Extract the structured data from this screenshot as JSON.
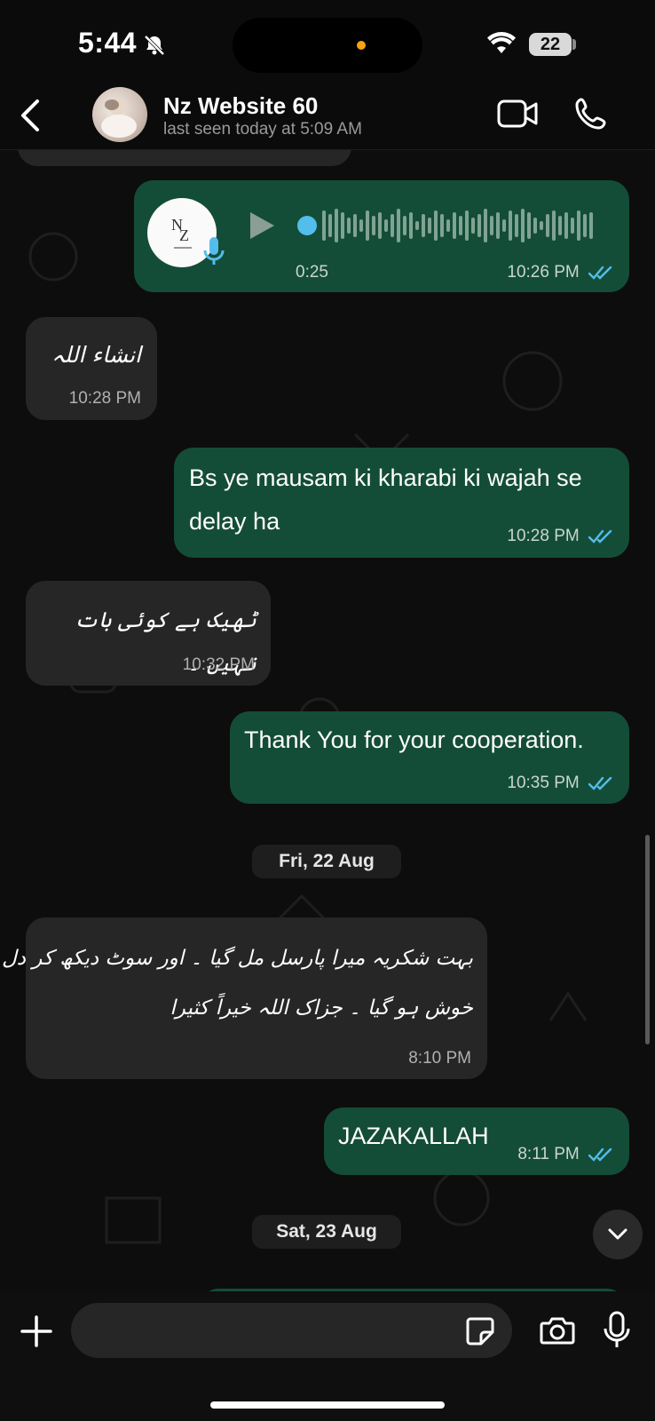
{
  "status_bar": {
    "time": "5:44",
    "battery": "22"
  },
  "header": {
    "contact_name": "Nz Website 60",
    "last_seen": "last seen today at 5:09 AM"
  },
  "voice_message": {
    "duration": "0:25",
    "time": "10:26 PM"
  },
  "messages": [
    {
      "direction": "in",
      "text": "انشاء اللہ",
      "time": "10:28 PM"
    },
    {
      "direction": "out",
      "text_line1": "Bs ye mausam ki kharabi ki wajah se",
      "text_line2": "delay ha",
      "time": "10:28 PM"
    },
    {
      "direction": "in",
      "text": "ٹھیک ہے کوئی بات نہیں ۔",
      "time": "10:32 PM"
    },
    {
      "direction": "out",
      "text": "Thank You for your cooperation.",
      "time": "10:35 PM"
    },
    {
      "direction": "in",
      "text_line1": "بہت شکریہ میرا پارسل مل گیا ۔ اور سوٹ دیکھ کر دل",
      "text_line2": "خوش ہو گیا ۔ جزاک اللہ خیراً کثیرا",
      "time": "8:10 PM"
    },
    {
      "direction": "out",
      "text": "JAZAKALLAH",
      "time": "8:11 PM"
    }
  ],
  "date_separators": [
    "Fri, 22 Aug",
    "Sat, 23 Aug"
  ],
  "colors": {
    "outgoing_bubble": "#144d37",
    "incoming_bubble": "#262626",
    "read_ticks": "#53bdeb",
    "background": "#0b0b0b"
  }
}
